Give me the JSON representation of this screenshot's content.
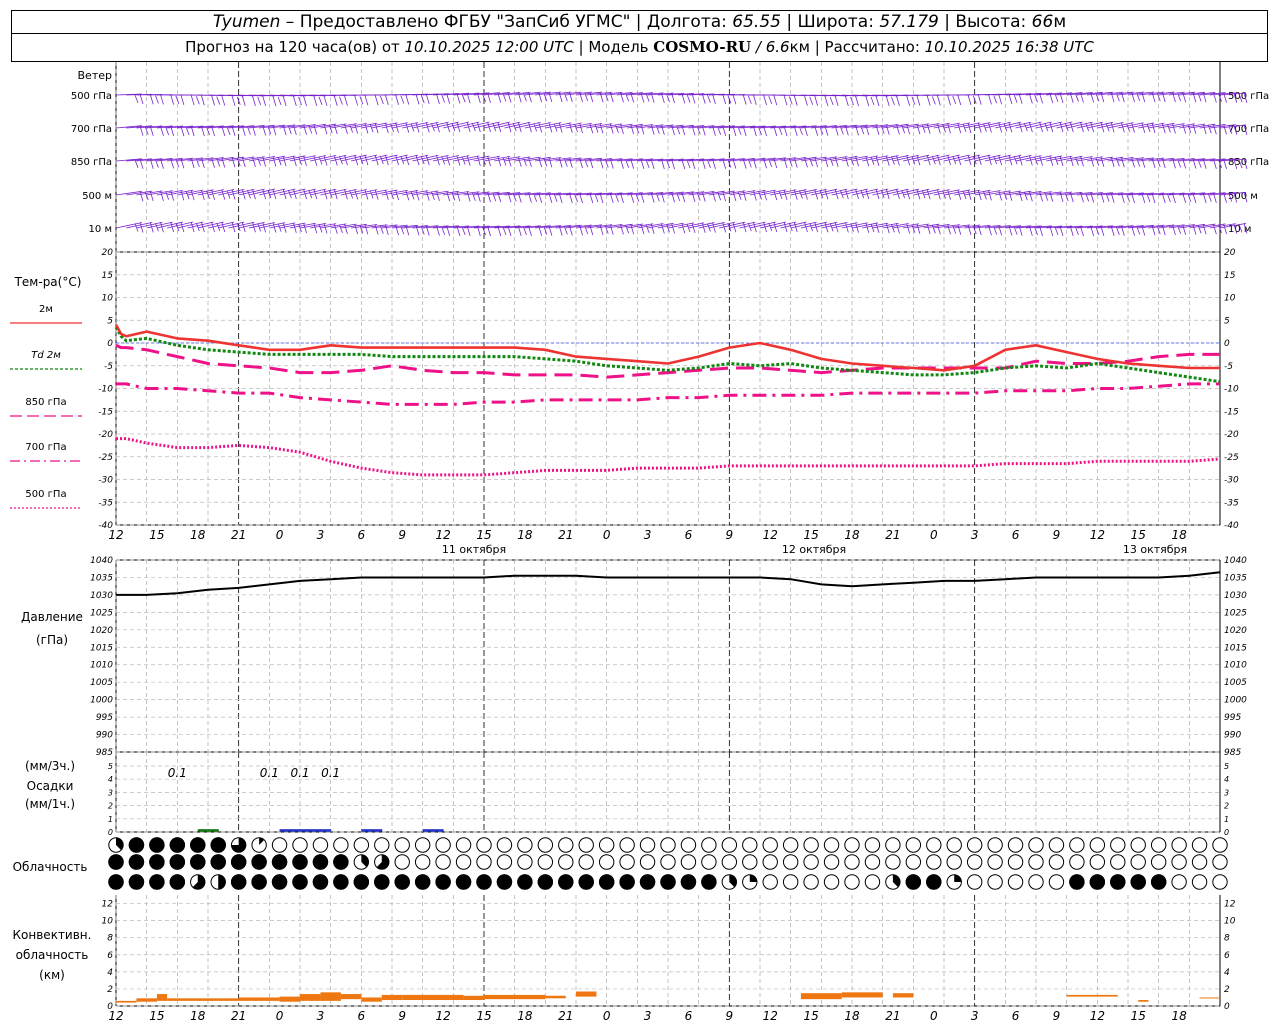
{
  "header": {
    "line1": {
      "city": "Tyumen",
      "provider": " – Предоставлено ФГБУ \"ЗапСиб УГМС\" | Долгота: ",
      "lon": "65.55",
      "lat_label": " | Широта: ",
      "lat": "57.179",
      "alt_label": " | Высота: ",
      "alt": "66",
      "alt_unit": "м"
    },
    "line2": {
      "prefix": "Прогноз на 120 часа(ов) от ",
      "init": "10.10.2025 12:00 UTC",
      "model_label": " | Модель ",
      "model": "COSMO-RU",
      "res": " / 6.6",
      "res_unit": "км",
      "calc_label": " | Рассчитано: ",
      "calc": "10.10.2025 16:38 UTC"
    }
  },
  "labels": {
    "wind": "Ветер",
    "wind_levels": [
      "500 гПа",
      "700 гПа",
      "850 гПа",
      "500 м",
      "10 м"
    ],
    "temp_title": "Тем-ра(°C)",
    "temp_legend": [
      "2м",
      "Td 2м",
      "850 гПа",
      "700 гПа",
      "500 гПа"
    ],
    "pressure": [
      "Давление",
      "(гПа)"
    ],
    "precip": [
      "(мм/3ч.)",
      "Осадки",
      "(мм/1ч.)"
    ],
    "cloud": "Облачность",
    "conv": [
      "Конвективн.",
      "облачность",
      "(км)"
    ]
  },
  "x_hours": [
    "12",
    "15",
    "18",
    "21",
    "0",
    "3",
    "6",
    "9",
    "12",
    "15",
    "18",
    "21",
    "0",
    "3",
    "6",
    "9",
    "12",
    "15",
    "18",
    "21",
    "0",
    "3",
    "6",
    "9",
    "12",
    "15",
    "18"
  ],
  "day_labels": [
    "11 октября",
    "12 октября",
    "13 октября"
  ],
  "colors": {
    "t2m": "#ee3333",
    "td2m": "#118811",
    "t850": "#ee1188",
    "t700": "#ee1188",
    "t500": "#ee1188",
    "wind": "#7722cc",
    "zero": "#3355ee",
    "conv": "#ee7711"
  },
  "chart_data": [
    {
      "type": "line",
      "name": "temperature",
      "title": "Тем-ра(°C)",
      "ylim": [
        -40,
        20
      ],
      "yticks": [
        20,
        15,
        10,
        5,
        0,
        -5,
        -10,
        -15,
        -20,
        -25,
        -30,
        -35,
        -40
      ],
      "x_hours_since_start": [
        0,
        0.5,
        1,
        3,
        6,
        9,
        12,
        15,
        18,
        21,
        24,
        27,
        30,
        33,
        36,
        39,
        42,
        45,
        48,
        51,
        54,
        57,
        60,
        63,
        66,
        69,
        72,
        75,
        78,
        81,
        84,
        87,
        90,
        93,
        96,
        99,
        102,
        105,
        108
      ],
      "series": [
        {
          "name": "2м",
          "values": [
            4,
            2,
            1.5,
            2.5,
            1,
            0.5,
            -0.5,
            -1.5,
            -1.5,
            -0.5,
            -1,
            -1,
            -1,
            -1,
            -1,
            -1,
            -1.5,
            -3,
            -3.5,
            -4,
            -4.5,
            -3,
            -1,
            0,
            -1.5,
            -3.5,
            -4.5,
            -5,
            -5.5,
            -6,
            -5,
            -1.5,
            -0.5,
            -2,
            -3.5,
            -4.5,
            -5,
            -5.5,
            -5.5
          ]
        },
        {
          "name": "Td 2м",
          "values": [
            3.5,
            1.5,
            0.5,
            1,
            -0.5,
            -1.5,
            -2,
            -2.5,
            -2.5,
            -2.5,
            -2.5,
            -3,
            -3,
            -3,
            -3,
            -3,
            -3.5,
            -4,
            -5,
            -5.5,
            -6,
            -5.5,
            -4.5,
            -5,
            -4.5,
            -5.5,
            -6,
            -6.5,
            -7,
            -7,
            -6.5,
            -5.5,
            -5,
            -5.5,
            -4.5,
            -5.5,
            -6.5,
            -7.5,
            -8.5
          ]
        },
        {
          "name": "850 гПа",
          "values": [
            -0.5,
            -1,
            -1,
            -1.5,
            -3,
            -4.5,
            -5,
            -5.5,
            -6.5,
            -6.5,
            -6,
            -5,
            -6,
            -6.5,
            -6.5,
            -7,
            -7,
            -7,
            -7.5,
            -7,
            -6.5,
            -6,
            -5.5,
            -5.5,
            -6,
            -6.5,
            -6,
            -5.5,
            -5.5,
            -5.5,
            -5.5,
            -5.5,
            -4,
            -4.5,
            -4.5,
            -4,
            -3,
            -2.5,
            -2.5
          ]
        },
        {
          "name": "700 гПа",
          "values": [
            -9,
            -9,
            -9,
            -10,
            -10,
            -10.5,
            -11,
            -11,
            -12,
            -12.5,
            -13,
            -13.5,
            -13.5,
            -13.5,
            -13,
            -13,
            -12.5,
            -12.5,
            -12.5,
            -12.5,
            -12,
            -12,
            -11.5,
            -11.5,
            -11.5,
            -11.5,
            -11,
            -11,
            -11,
            -11,
            -11,
            -10.5,
            -10.5,
            -10.5,
            -10,
            -10,
            -9.5,
            -9,
            -9
          ]
        },
        {
          "name": "500 гПа",
          "values": [
            -21,
            -21,
            -21,
            -22,
            -23,
            -23,
            -22.5,
            -23,
            -24,
            -26,
            -27.5,
            -28.5,
            -29,
            -29,
            -29,
            -28.5,
            -28,
            -28,
            -28,
            -27.5,
            -27.5,
            -27.5,
            -27,
            -27,
            -27,
            -27,
            -27,
            -27,
            -27,
            -27,
            -27,
            -26.5,
            -26.5,
            -26.5,
            -26,
            -26,
            -26,
            -26,
            -25.5
          ]
        }
      ]
    },
    {
      "type": "line",
      "name": "pressure",
      "title": "Давление (гПа)",
      "ylim": [
        985,
        1040
      ],
      "yticks": [
        1040,
        1035,
        1030,
        1025,
        1020,
        1015,
        1010,
        1005,
        1000,
        995,
        990,
        985
      ],
      "x_hours_since_start": [
        0,
        3,
        6,
        9,
        12,
        15,
        18,
        21,
        24,
        27,
        30,
        33,
        36,
        39,
        42,
        45,
        48,
        51,
        54,
        57,
        60,
        63,
        66,
        69,
        72,
        75,
        78,
        81,
        84,
        87,
        90,
        93,
        96,
        99,
        102,
        105,
        108
      ],
      "series": [
        {
          "name": "Давление",
          "values": [
            1030,
            1030,
            1030.5,
            1031.5,
            1032,
            1033,
            1034,
            1034.5,
            1035,
            1035,
            1035,
            1035,
            1035,
            1035.5,
            1035.5,
            1035.5,
            1035,
            1035,
            1035,
            1035,
            1035,
            1035,
            1034.5,
            1033,
            1032.5,
            1033,
            1033.5,
            1034,
            1034,
            1034.5,
            1035,
            1035,
            1035,
            1035,
            1035,
            1035.5,
            1036.5
          ]
        }
      ]
    },
    {
      "type": "bar",
      "name": "precipitation",
      "title": "Осадки",
      "ylim": [
        0,
        5
      ],
      "yticks": [
        5,
        4,
        3,
        2,
        1,
        0
      ],
      "annotations": [
        {
          "x_hour": 6,
          "label": "0.1"
        },
        {
          "x_hour": 15,
          "label": "0.1"
        },
        {
          "x_hour": 18,
          "label": "0.1"
        },
        {
          "x_hour": 21,
          "label": "0.1"
        }
      ],
      "series": [
        {
          "name": "3h",
          "values": [
            [
              8,
              0.1
            ],
            [
              9,
              0.1
            ],
            [
              16,
              0.1
            ],
            [
              17,
              0.1
            ],
            [
              18,
              0.1
            ],
            [
              19,
              0.1
            ],
            [
              20,
              0.1
            ],
            [
              24,
              0.1
            ],
            [
              25,
              0.1
            ],
            [
              30,
              0.1
            ],
            [
              31,
              0.1
            ]
          ]
        }
      ]
    },
    {
      "type": "table",
      "name": "cloud_cover",
      "title": "Облачность",
      "hours_per_column": 2,
      "rows": {
        "high": "3888886100000000000000000000000000000000000000000000000",
        "mid": "8888888888883500000000000000000000000000000000000000000",
        "low": "8888548888888888888888888888883200000000000000000000000"
      },
      "low_extra": [
        [
          38,
          3
        ],
        [
          39,
          8
        ],
        [
          40,
          8
        ],
        [
          41,
          2
        ],
        [
          47,
          8
        ],
        [
          48,
          8
        ],
        [
          49,
          8
        ],
        [
          50,
          8
        ],
        [
          51,
          8
        ]
      ]
    },
    {
      "type": "bar",
      "name": "convective_cloud",
      "title": "Конвективн. облачность (км)",
      "ylim": [
        0,
        13
      ],
      "yticks": [
        12,
        10,
        8,
        6,
        4,
        2,
        0
      ],
      "segments_km": [
        [
          0,
          2,
          0.4,
          0.6
        ],
        [
          2,
          4,
          0.5,
          0.9
        ],
        [
          4,
          5,
          0.6,
          1.4
        ],
        [
          5,
          10,
          0.6,
          0.9
        ],
        [
          10,
          12,
          0.6,
          0.9
        ],
        [
          12,
          16,
          0.6,
          1.0
        ],
        [
          16,
          18,
          0.5,
          1.1
        ],
        [
          18,
          20,
          0.6,
          1.4
        ],
        [
          20,
          22,
          0.6,
          1.6
        ],
        [
          22,
          24,
          0.8,
          1.4
        ],
        [
          24,
          26,
          0.5,
          1.0
        ],
        [
          26,
          28,
          0.7,
          1.3
        ],
        [
          28,
          34,
          0.7,
          1.3
        ],
        [
          34,
          36,
          0.7,
          1.2
        ],
        [
          36,
          42,
          0.8,
          1.3
        ],
        [
          42,
          44,
          0.9,
          1.2
        ],
        [
          45,
          47,
          1.1,
          1.7
        ],
        [
          67,
          71,
          0.8,
          1.5
        ],
        [
          71,
          75,
          1.0,
          1.6
        ],
        [
          76,
          78,
          1.0,
          1.5
        ],
        [
          93,
          98,
          1.1,
          1.3
        ],
        [
          100,
          101,
          0.5,
          0.7
        ],
        [
          106,
          108,
          0.9,
          1.0
        ]
      ]
    }
  ]
}
